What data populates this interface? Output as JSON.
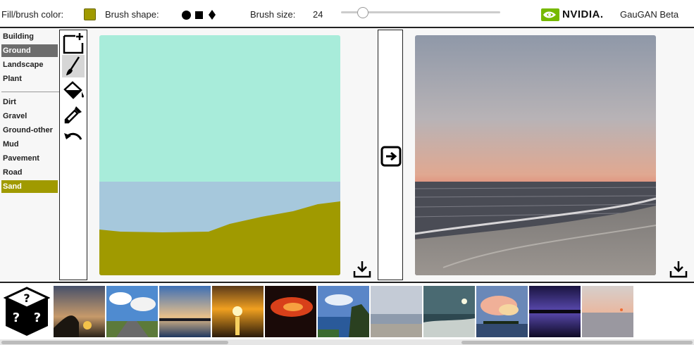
{
  "topbar": {
    "fill_label": "Fill/brush color:",
    "fill_color": "#a09a00",
    "shape_label": "Brush shape:",
    "shapes": [
      "circle-icon",
      "square-icon",
      "diamond-icon"
    ],
    "size_label": "Brush size:",
    "size_value": "24",
    "slider_fraction": 0.11,
    "brand": "NVIDIA.",
    "app_title": "GauGAN Beta"
  },
  "labels": {
    "group1": [
      "Building",
      "Ground",
      "Landscape",
      "Plant"
    ],
    "group2": [
      "Dirt",
      "Gravel",
      "Ground-other",
      "Mud",
      "Pavement",
      "Road",
      "Sand"
    ],
    "selected_category": "Ground",
    "selected_label": "Sand"
  },
  "tools": [
    "new-canvas-icon",
    "brush-icon",
    "fill-bucket-icon",
    "eyedropper-icon",
    "undo-icon"
  ],
  "colors": {
    "sky": "#a8ecda",
    "sea": "#a6c8dc",
    "sand": "#a09a00",
    "ground_selected": "#6d6d6d"
  },
  "thumbnails": [
    "sunset-tree",
    "road-clouds",
    "lake-dusk",
    "sun-reflection",
    "red-sunset",
    "coast-cliff",
    "grey-beach",
    "night-shore",
    "pink-clouds",
    "purple-sunset",
    "calm-sea"
  ]
}
